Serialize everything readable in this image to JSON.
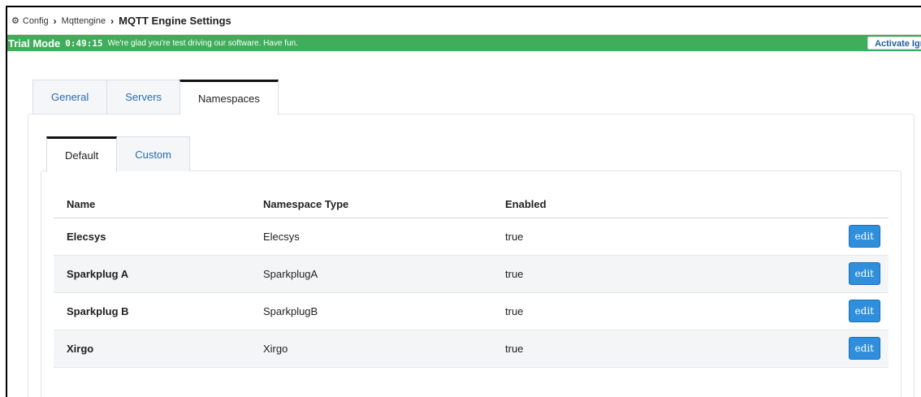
{
  "breadcrumb": {
    "icon": "gear-icon",
    "items": [
      "Config",
      "Mqttengine"
    ],
    "current": "MQTT Engine Settings"
  },
  "trial": {
    "label": "Trial Mode",
    "timer": "0:49:15",
    "message": "We're glad you're test driving our software. Have fun.",
    "activate_label": "Activate Igr",
    "color": "#3fae5a"
  },
  "tabs": [
    "General",
    "Servers",
    "Namespaces"
  ],
  "active_tab": "Namespaces",
  "subtabs": [
    "Default",
    "Custom"
  ],
  "active_subtab": "Default",
  "table": {
    "headers": [
      "Name",
      "Namespace Type",
      "Enabled"
    ],
    "rows": [
      {
        "name": "Elecsys",
        "type": "Elecsys",
        "enabled": "true",
        "action": "edit"
      },
      {
        "name": "Sparkplug A",
        "type": "SparkplugA",
        "enabled": "true",
        "action": "edit"
      },
      {
        "name": "Sparkplug B",
        "type": "SparkplugB",
        "enabled": "true",
        "action": "edit"
      },
      {
        "name": "Xirgo",
        "type": "Xirgo",
        "enabled": "true",
        "action": "edit"
      }
    ]
  },
  "colors": {
    "accent": "#2f8fdc",
    "link": "#2b6cb0"
  }
}
